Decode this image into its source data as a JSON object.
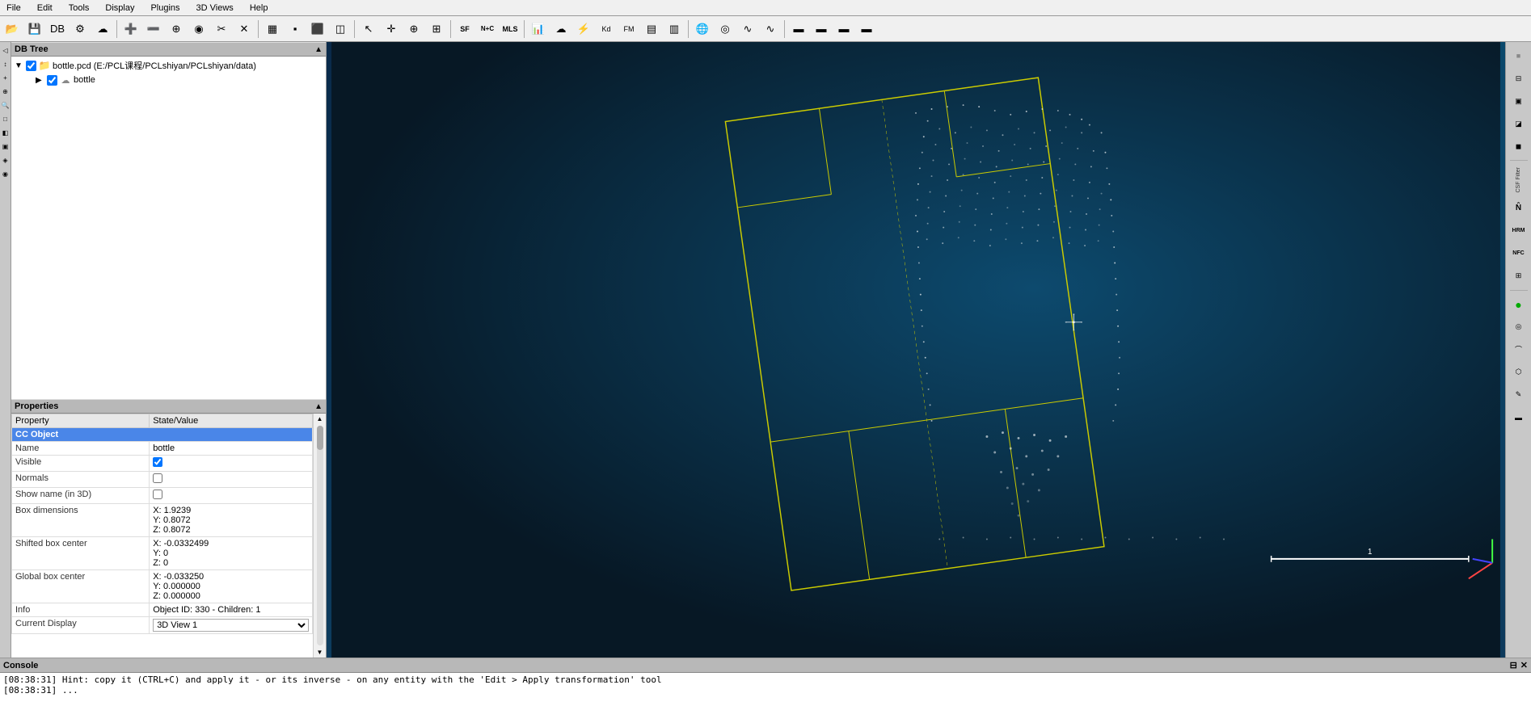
{
  "menu": {
    "items": [
      "File",
      "Edit",
      "Tools",
      "Display",
      "Plugins",
      "3D Views",
      "Help"
    ]
  },
  "toolbar": {
    "buttons": [
      {
        "name": "open",
        "icon": "📂"
      },
      {
        "name": "save",
        "icon": "💾"
      },
      {
        "name": "properties",
        "icon": "⚙"
      },
      {
        "name": "translate",
        "icon": "✚"
      },
      {
        "name": "rotate",
        "icon": "↻"
      },
      {
        "name": "scale",
        "icon": "⤢"
      },
      {
        "name": "delete",
        "icon": "✕"
      },
      {
        "name": "segment",
        "icon": "◉"
      },
      {
        "name": "filter1",
        "icon": "▦"
      },
      {
        "name": "filter2",
        "icon": "▪"
      },
      {
        "name": "filter3",
        "icon": "⬛"
      },
      {
        "name": "filter4",
        "icon": "◫"
      },
      {
        "name": "cursor",
        "icon": "↖"
      },
      {
        "name": "move",
        "icon": "✛"
      },
      {
        "name": "pan",
        "icon": "⊕"
      },
      {
        "name": "zoom",
        "icon": "🔍"
      },
      {
        "name": "sf",
        "icon": "SF"
      },
      {
        "name": "nplus",
        "icon": "N+C"
      },
      {
        "name": "mls2",
        "icon": "MLS"
      },
      {
        "name": "icon1",
        "icon": "▣"
      },
      {
        "name": "icon2",
        "icon": "⚡"
      },
      {
        "name": "icon3",
        "icon": "▩"
      },
      {
        "name": "kd",
        "icon": "Kd"
      },
      {
        "name": "fm",
        "icon": "FM"
      },
      {
        "name": "icon4",
        "icon": "▤"
      },
      {
        "name": "icon5",
        "icon": "▥"
      },
      {
        "name": "icon6",
        "icon": "◎"
      },
      {
        "name": "icon7",
        "icon": "⊙"
      },
      {
        "name": "icon8",
        "icon": "∿"
      },
      {
        "name": "icon9",
        "icon": "∿"
      },
      {
        "name": "icon10",
        "icon": "▬"
      },
      {
        "name": "icon11",
        "icon": "▬"
      },
      {
        "name": "icon12",
        "icon": "▬"
      },
      {
        "name": "icon13",
        "icon": "▬"
      }
    ]
  },
  "db_tree": {
    "title": "DB Tree",
    "items": [
      {
        "label": "bottle.pcd (E:/PCL课程/PCLshiyan/PCLshiyan/data)",
        "type": "file",
        "checked": true,
        "children": [
          {
            "label": "bottle",
            "type": "cloud",
            "checked": true
          }
        ]
      }
    ]
  },
  "properties": {
    "title": "Properties",
    "columns": {
      "property": "Property",
      "state_value": "State/Value"
    },
    "section": "CC Object",
    "rows": [
      {
        "property": "Name",
        "value": "bottle",
        "type": "text"
      },
      {
        "property": "Visible",
        "value": "checked",
        "type": "checkbox"
      },
      {
        "property": "Normals",
        "value": "unchecked",
        "type": "checkbox"
      },
      {
        "property": "Show name (in 3D)",
        "value": "unchecked",
        "type": "checkbox"
      },
      {
        "property": "Box dimensions",
        "value": "X: 1.9239\nY: 0.8072\nZ: 0.8072",
        "type": "multiline"
      },
      {
        "property": "Shifted box center",
        "value": "X: -0.0332499\nY: 0\nZ: 0",
        "type": "multiline"
      },
      {
        "property": "Global box center",
        "value": "X: -0.033250\nY: 0.000000\nZ: 0.000000",
        "type": "multiline"
      },
      {
        "property": "Info",
        "value": "Object ID: 330 - Children: 1",
        "type": "text"
      },
      {
        "property": "Current Display",
        "value": "3D View 1",
        "type": "dropdown"
      }
    ],
    "box_dimensions": {
      "x": "X: 1.9239",
      "y": "Y: 0.8072",
      "z": "Z: 0.8072"
    },
    "shifted_box_center": {
      "x": "X: -0.0332499",
      "y": "Y: 0",
      "z": "Z: 0"
    },
    "global_box_center": {
      "x": "X: -0.033250",
      "y": "Y: 0.000000",
      "z": "Z: 0.000000"
    }
  },
  "right_toolbar": {
    "label": "CSF Filter",
    "buttons": [
      {
        "name": "n-button",
        "icon": "N̂",
        "label": "N"
      },
      {
        "name": "hrm-button",
        "icon": "HRM"
      },
      {
        "name": "nfc-button",
        "icon": "NFC"
      },
      {
        "name": "grid-button",
        "icon": "⊞"
      },
      {
        "name": "circle-button",
        "icon": "○"
      },
      {
        "name": "rog-button",
        "icon": "◎"
      },
      {
        "name": "arc-button",
        "icon": "⌒"
      },
      {
        "name": "shape-button",
        "icon": "⬡"
      },
      {
        "name": "edit-button",
        "icon": "✎"
      },
      {
        "name": "bar-button",
        "icon": "▬"
      }
    ]
  },
  "console": {
    "title": "Console",
    "messages": [
      "[08:38:31] Hint: copy it (CTRL+C) and apply it - or its inverse - on any entity with the 'Edit > Apply transformation' tool",
      "[08:38:31] ..."
    ]
  },
  "viewport": {
    "title": "3D View 1",
    "background_color": "#0a3a5c",
    "crosshair_visible": true
  }
}
